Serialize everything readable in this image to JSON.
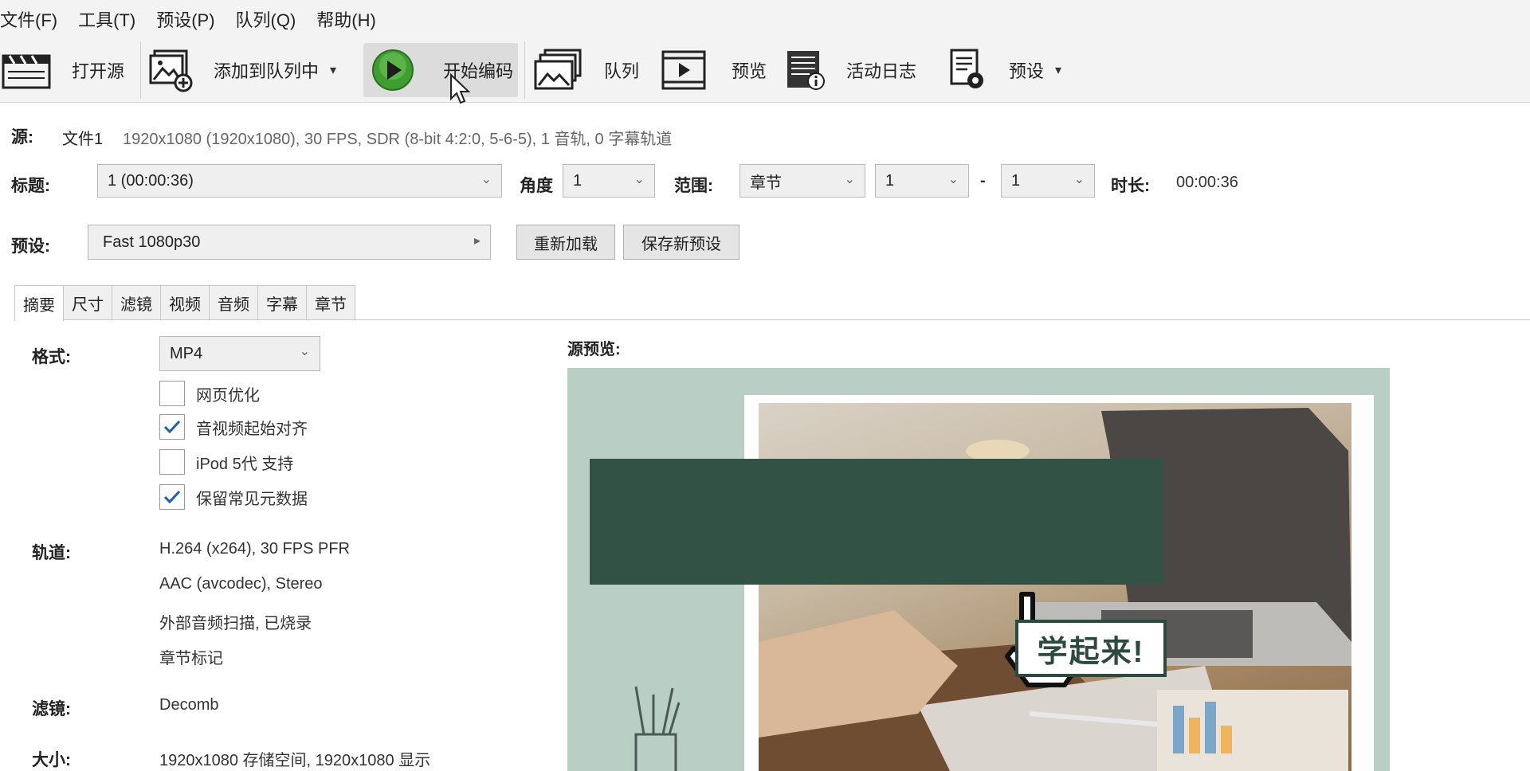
{
  "menu": [
    "文件(F)",
    "工具(T)",
    "预设(P)",
    "队列(Q)",
    "帮助(H)"
  ],
  "toolbar": {
    "open_source": "打开源",
    "add_to_queue": "添加到队列中",
    "start_encode": "开始编码",
    "queue": "队列",
    "preview": "预览",
    "activity_log": "活动日志",
    "presets": "预设",
    "caret": "▾"
  },
  "source": {
    "label": "源:",
    "name": "文件1",
    "info": "1920x1080 (1920x1080), 30 FPS, SDR (8-bit 4:2:0, 5-6-5), 1 音轨, 0 字幕轨道"
  },
  "title_row": {
    "title_label": "标题:",
    "title_value": "1 (00:00:36)",
    "angle_label": "角度",
    "angle_value": "1",
    "range_label": "范围:",
    "range_type": "章节",
    "range_start": "1",
    "range_dash": "-",
    "range_end": "1",
    "duration_label": "时长:",
    "duration_value": "00:00:36"
  },
  "preset_row": {
    "label": "预设:",
    "value": "Fast 1080p30",
    "reload": "重新加载",
    "save_new": "保存新预设"
  },
  "tabs": [
    "摘要",
    "尺寸",
    "滤镜",
    "视频",
    "音频",
    "字幕",
    "章节"
  ],
  "summary": {
    "format_label": "格式:",
    "format_value": "MP4",
    "options": [
      {
        "label": "网页优化",
        "checked": false
      },
      {
        "label": "音视频起始对齐",
        "checked": true
      },
      {
        "label": "iPod 5代 支持",
        "checked": false
      },
      {
        "label": "保留常见元数据",
        "checked": true
      }
    ],
    "tracks_label": "轨道:",
    "tracks": [
      "H.264 (x264), 30 FPS PFR",
      "AAC (avcodec), Stereo",
      "外部音频扫描, 已烧录",
      "章节标记"
    ],
    "filters_label": "滤镜:",
    "filters_value": "Decomb",
    "size_label": "大小:",
    "size_value": "1920x1080 存储空间, 1920x1080 显示"
  },
  "preview": {
    "label": "源预览:",
    "overlay_text": "学起来!"
  },
  "colors": {
    "play_green": "#3f9e2f",
    "preview_bg": "#b9cec5",
    "overlay_block": "#315244",
    "check_blue": "#1f5fa8"
  }
}
